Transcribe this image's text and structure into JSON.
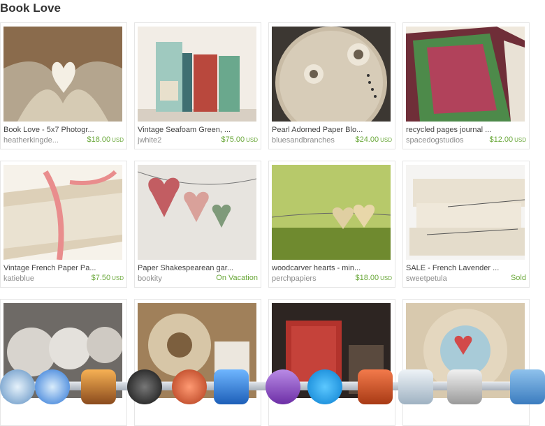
{
  "page": {
    "title": "Book Love"
  },
  "currency": "USD",
  "items": [
    {
      "name": "Book Love - 5x7 Photogr...",
      "shop": "heatherkingde...",
      "price": "$18.00",
      "status": ""
    },
    {
      "name": "Vintage Seafoam Green, ...",
      "shop": "jwhite2",
      "price": "$75.00",
      "status": ""
    },
    {
      "name": "Pearl Adorned Paper Blo...",
      "shop": "bluesandbranches",
      "price": "$24.00",
      "status": ""
    },
    {
      "name": "recycled pages journal ...",
      "shop": "spacedogstudios",
      "price": "$12.00",
      "status": ""
    },
    {
      "name": "Vintage French Paper Pa...",
      "shop": "katieblue",
      "price": "$7.50",
      "status": ""
    },
    {
      "name": "Paper Shakespearean gar...",
      "shop": "bookity",
      "price": "",
      "status": "On Vacation"
    },
    {
      "name": "woodcarver hearts - min...",
      "shop": "perchpapiers",
      "price": "$18.00",
      "status": ""
    },
    {
      "name": "SALE - French Lavender ...",
      "shop": "sweetpetula",
      "price": "",
      "status": "Sold"
    },
    {
      "name": "",
      "shop": "",
      "price": "",
      "status": ""
    },
    {
      "name": "",
      "shop": "",
      "price": "",
      "status": ""
    },
    {
      "name": "",
      "shop": "",
      "price": "",
      "status": ""
    },
    {
      "name": "",
      "shop": "",
      "price": "",
      "status": ""
    }
  ],
  "dock": {
    "icons": [
      "safari-icon",
      "itunes-icon",
      "iphoto-icon",
      "camera-icon",
      "photo-booth-icon",
      "garageband-icon",
      "onenote-icon",
      "skype-icon",
      "finder-folder-icon",
      "preview-icon",
      "scissors-app-icon",
      "folder-icon"
    ]
  }
}
